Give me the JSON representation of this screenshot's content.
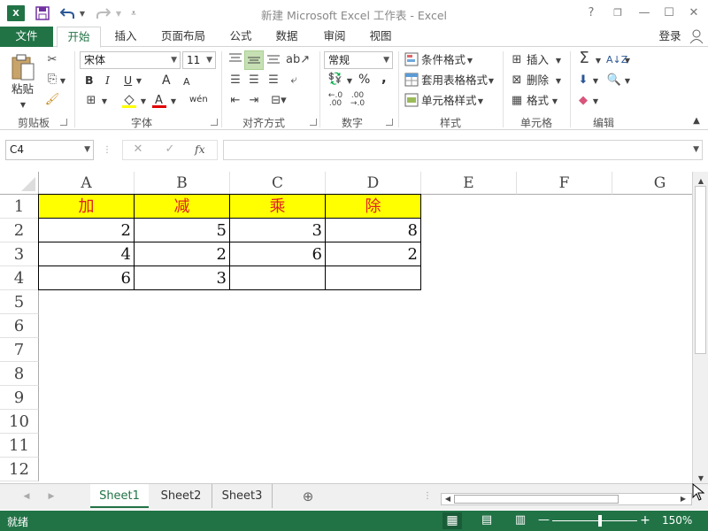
{
  "window": {
    "title": "新建 Microsoft Excel 工作表 - Excel",
    "controls": [
      "?",
      "❐",
      "—",
      "☐",
      "✕"
    ]
  },
  "quick_access": {
    "app_icon": "excel-logo-icon",
    "save": "save-icon",
    "undo": "undo-icon",
    "redo": "redo-icon",
    "customize": "customize-icon"
  },
  "tabs": {
    "file": "文件",
    "items": [
      "开始",
      "插入",
      "页面布局",
      "公式",
      "数据",
      "审阅",
      "视图"
    ],
    "active": "开始",
    "login": "登录"
  },
  "ribbon": {
    "clipboard": {
      "label": "剪贴板",
      "paste": "粘贴"
    },
    "font": {
      "label": "字体",
      "name": "宋体",
      "size": "11",
      "bold": "B",
      "italic": "I",
      "underline": "U",
      "grow": "A",
      "shrink": "A",
      "phonetic": "wén"
    },
    "alignment": {
      "label": "对齐方式"
    },
    "number": {
      "label": "数字",
      "format": "常规",
      "percent": "%",
      "comma": ","
    },
    "styles": {
      "label": "样式",
      "conditional": "条件格式",
      "table": "套用表格格式",
      "cell": "单元格样式"
    },
    "cells": {
      "label": "单元格",
      "insert": "插入",
      "delete": "删除",
      "format": "格式"
    },
    "editing": {
      "label": "编辑"
    }
  },
  "formula_bar": {
    "name_box": "C4",
    "fx": "fx",
    "content": ""
  },
  "sheet": {
    "columns": [
      "A",
      "B",
      "C",
      "D",
      "E",
      "F",
      "G"
    ],
    "rows": [
      "1",
      "2",
      "3",
      "4",
      "5",
      "6",
      "7",
      "8",
      "9",
      "10",
      "11",
      "12"
    ],
    "data": [
      [
        "加",
        "减",
        "乘",
        "除"
      ],
      [
        "2",
        "5",
        "3",
        "8"
      ],
      [
        "4",
        "2",
        "6",
        "2"
      ],
      [
        "6",
        "3",
        "",
        ""
      ]
    ],
    "header_fill": "#ffff00",
    "header_text_color": "#e02020"
  },
  "sheet_tabs": {
    "items": [
      "Sheet1",
      "Sheet2",
      "Sheet3"
    ],
    "active": "Sheet1"
  },
  "status": {
    "ready": "就绪",
    "zoom": "150%"
  },
  "colors": {
    "accent": "#217346"
  }
}
